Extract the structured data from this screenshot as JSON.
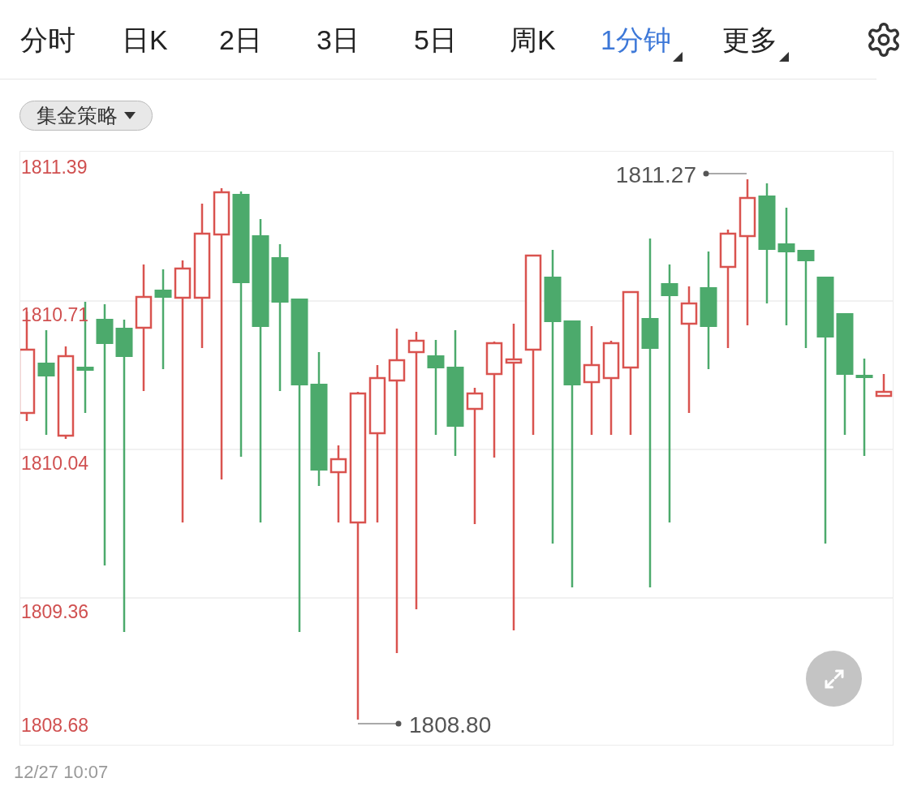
{
  "tabs": [
    {
      "label": "分时",
      "selected": false,
      "dropdown": false
    },
    {
      "label": "日K",
      "selected": false,
      "dropdown": false
    },
    {
      "label": "2日",
      "selected": false,
      "dropdown": false
    },
    {
      "label": "3日",
      "selected": false,
      "dropdown": false
    },
    {
      "label": "5日",
      "selected": false,
      "dropdown": false
    },
    {
      "label": "周K",
      "selected": false,
      "dropdown": false
    },
    {
      "label": "1分钟",
      "selected": true,
      "dropdown": true
    },
    {
      "label": "更多",
      "selected": false,
      "dropdown": true
    }
  ],
  "indicator_dropdown": {
    "label": "集金策略"
  },
  "chart": {
    "y_labels": [
      "1811.39",
      "1810.71",
      "1810.04",
      "1809.36",
      "1808.68"
    ],
    "high_label": "1811.27",
    "low_label": "1808.80"
  },
  "timestamp": "12/27 10:07"
}
